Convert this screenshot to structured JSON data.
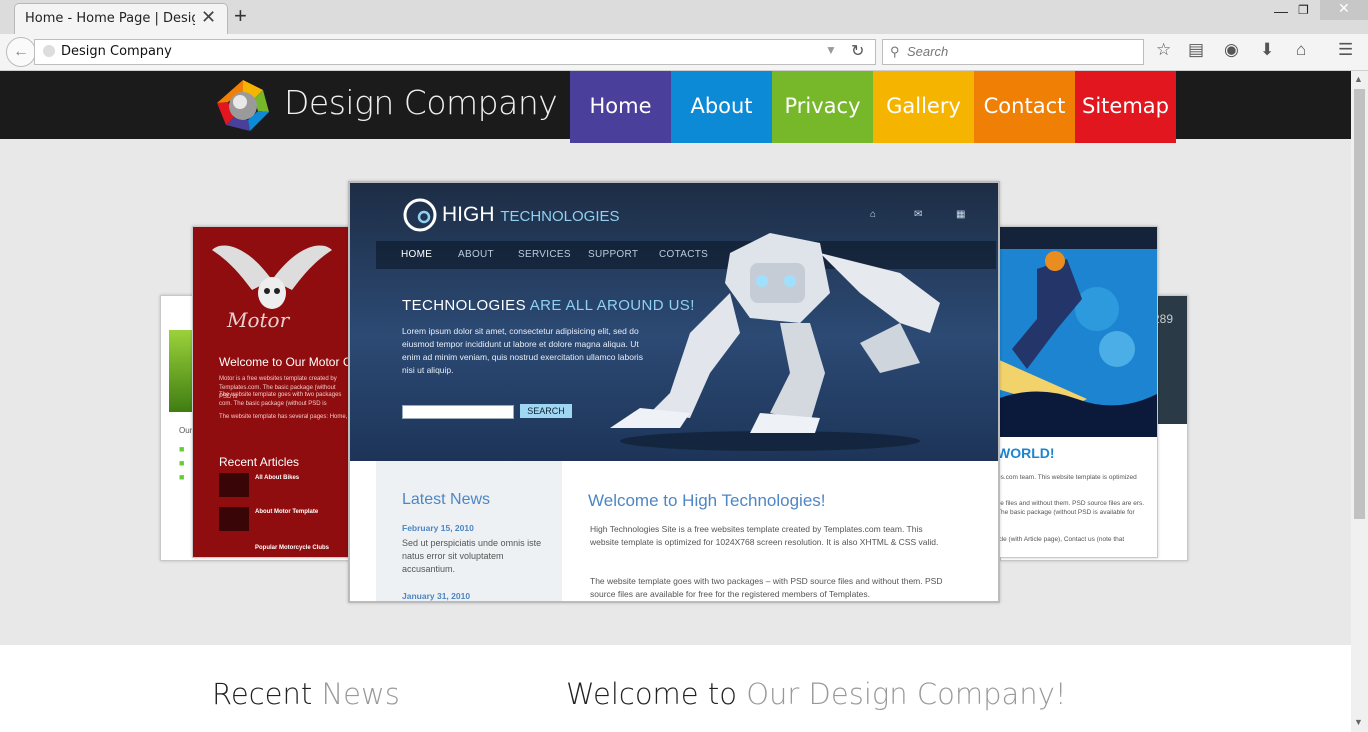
{
  "browser": {
    "tab_title": "Home - Home Page | Design ...",
    "url": "Design Company",
    "search_placeholder": "Search",
    "new_tab": "+",
    "close_tab": "✕"
  },
  "site": {
    "brand": "Design Company",
    "menu": [
      {
        "label": "Home",
        "color": "#4a3f9a"
      },
      {
        "label": "About",
        "color": "#0c8ad6"
      },
      {
        "label": "Privacy",
        "color": "#76b82a"
      },
      {
        "label": "Gallery",
        "color": "#f5b400"
      },
      {
        "label": "Contact",
        "color": "#f07f06"
      },
      {
        "label": "Sitemap",
        "color": "#e1161f"
      }
    ]
  },
  "slider": {
    "main": {
      "logo_main": "HIGH",
      "logo_sub": "TECHNOLOGIES",
      "nav": [
        "HOME",
        "ABOUT",
        "SERVICES",
        "SUPPORT",
        "COTACTS"
      ],
      "tagline_main": "TECHNOLOGIES",
      "tagline_sub": "ARE ALL AROUND US!",
      "lorem": "Lorem ipsum dolor sit amet, consectetur adipisicing elit, sed do eiusmod tempor incididunt ut labore et dolore magna aliqua. Ut enim ad minim veniam, quis nostrud exercitation ullamco laboris nisi ut aliquip.",
      "search_button": "SEARCH",
      "latest_news": "Latest News",
      "date1": "February 15, 2010",
      "side_text": "Sed ut perspiciatis unde omnis iste natus error sit voluptatem accusantium.",
      "date2": "January 31, 2010",
      "welcome": "Welcome to High Technologies!",
      "p1": "High Technologies Site is a free websites template created by Templates.com team. This website template is optimized for 1024X768 screen resolution. It is also XHTML & CSS valid.",
      "p2": "The website template goes with two packages – with PSD source files and without them. PSD source files are available for free for the registered members of Templates."
    },
    "motor": {
      "title": "Welcome to Our Motor Club",
      "p1": "Motor is a free websites template created by Templates.com. The basic package (without PSD is",
      "p2": "The website template goes with two packages com. The basic package (without PSD is",
      "p3": "The website template has several pages: Home,",
      "recent": "Recent Articles",
      "items": [
        "All About Bikes",
        "About Motor Template",
        "Popular Motorcycle Clubs"
      ]
    },
    "snow": {
      "world": "WORLD!",
      "t1": "es.com team. This website template is optimized",
      "t2": "ce files and without them. PSD source files are ers. The basic package (without PSD is available for",
      "t3": "icle (with Article page), Contact us (note that"
    },
    "back_right_number": "289"
  },
  "bottom": {
    "recent_1": "Recent",
    "recent_2": "News",
    "welcome_1": "Welcome to",
    "welcome_2": "Our Design Company!"
  }
}
